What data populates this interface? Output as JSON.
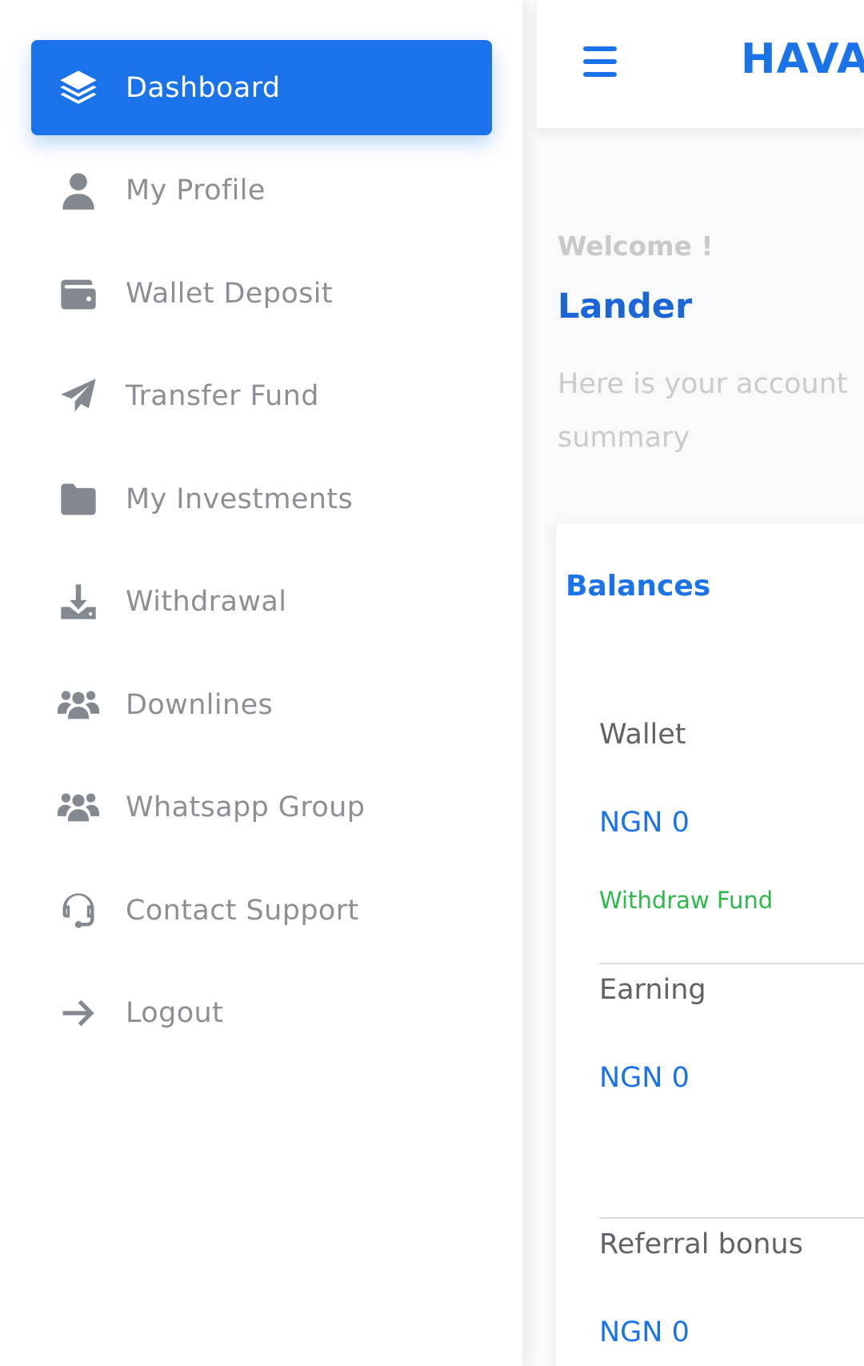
{
  "sidebar": {
    "items": [
      {
        "label": "Dashboard",
        "icon": "layers-icon",
        "active": true
      },
      {
        "label": "My Profile",
        "icon": "user-icon"
      },
      {
        "label": "Wallet Deposit",
        "icon": "wallet-icon"
      },
      {
        "label": "Transfer Fund",
        "icon": "paper-plane-icon"
      },
      {
        "label": "My Investments",
        "icon": "folder-icon"
      },
      {
        "label": "Withdrawal",
        "icon": "download-icon"
      },
      {
        "label": "Downlines",
        "icon": "users-icon"
      },
      {
        "label": "Whatsapp Group",
        "icon": "users-icon"
      },
      {
        "label": "Contact Support",
        "icon": "headset-icon"
      },
      {
        "label": "Logout",
        "icon": "arrow-right-icon"
      }
    ]
  },
  "header": {
    "brand": "HAVAR",
    "menu_icon": "hamburger-icon"
  },
  "main": {
    "welcome": "Welcome !",
    "username": "Lander",
    "summary": "Here is your account summary",
    "balances": {
      "title": "Balances",
      "wallet": {
        "label": "Wallet",
        "value": "NGN 0",
        "action": "Withdraw Fund"
      },
      "earning": {
        "label": "Earning",
        "value": "NGN 0"
      },
      "referral": {
        "label": "Referral bonus",
        "value": "NGN 0"
      }
    }
  },
  "colors": {
    "primary": "#1a73e8",
    "success": "#2bb94a",
    "muted_text": "#8c9096",
    "icon_gray": "#838991"
  }
}
